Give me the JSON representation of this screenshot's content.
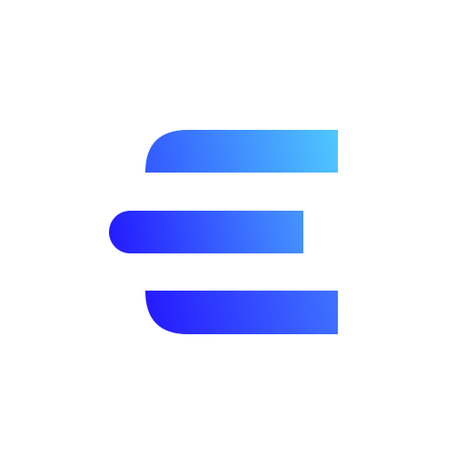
{
  "logo": {
    "icon": "letter-e-logo-icon",
    "colors": {
      "gradient_start": "#2418FF",
      "gradient_mid": "#3F73FF",
      "gradient_end": "#4FC8FF",
      "background": "#FFFFFF"
    }
  }
}
